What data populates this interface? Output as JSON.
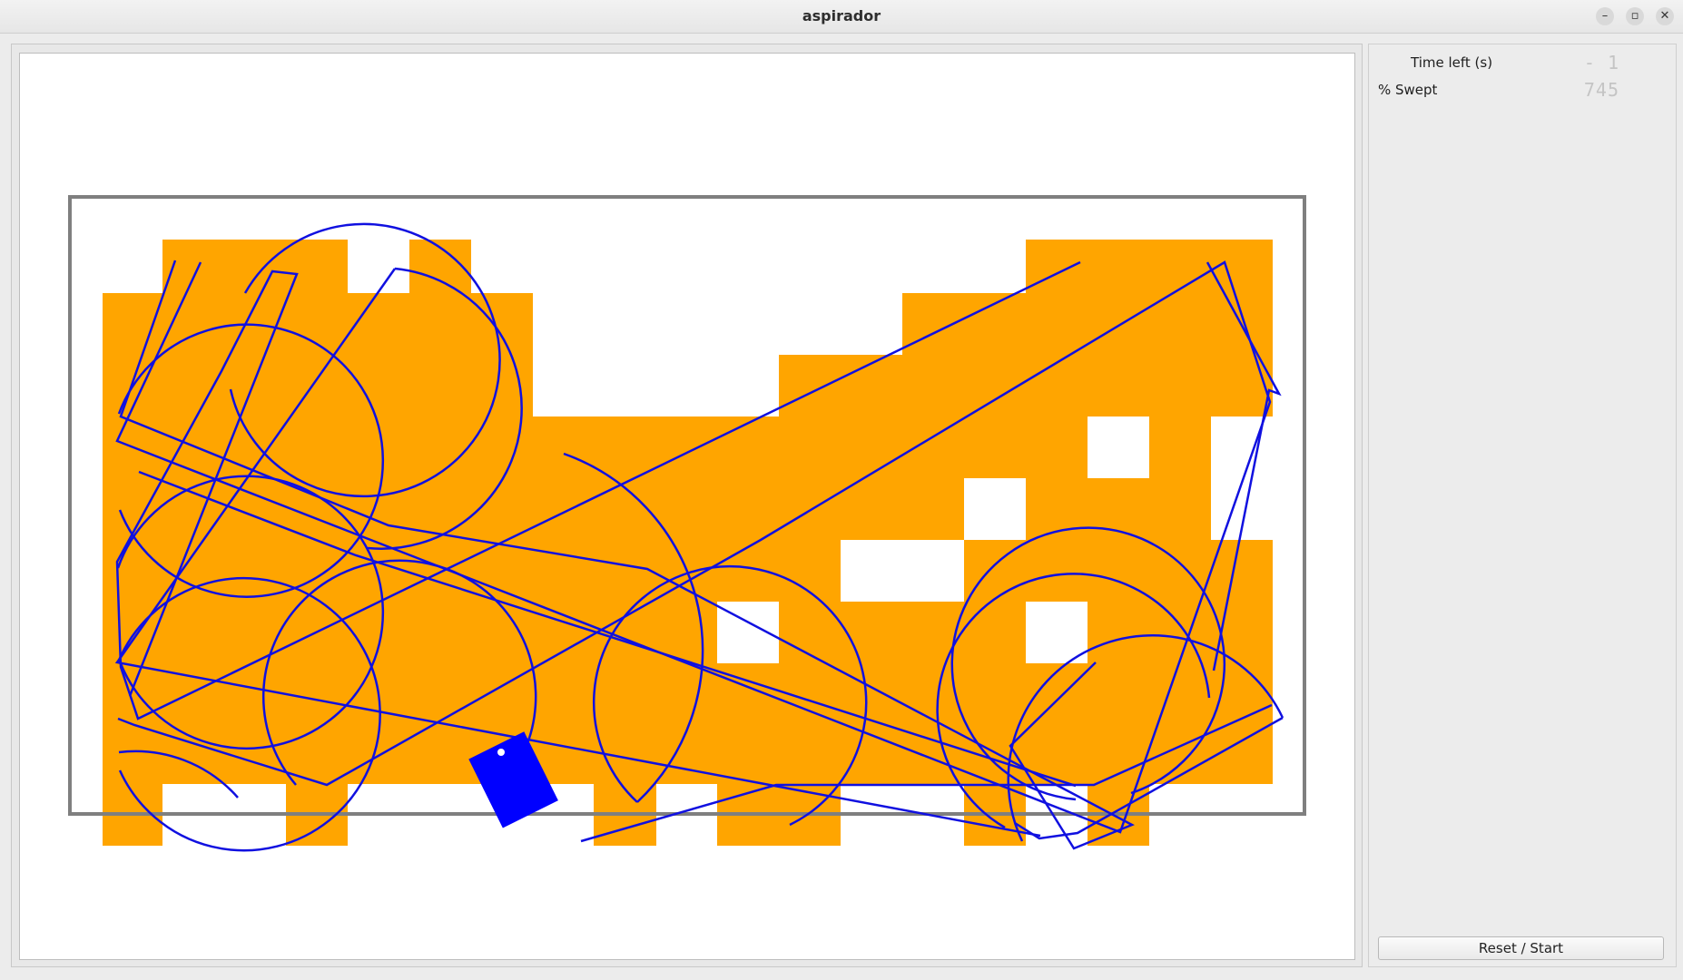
{
  "window": {
    "title": "aspirador",
    "minimize_glyph": "–",
    "restore_glyph": "▫",
    "close_glyph": "✕"
  },
  "stats": {
    "time_left_label": "Time left (s)",
    "time_left_value": "- 1",
    "swept_label": "% Swept",
    "swept_value": "745"
  },
  "controls": {
    "reset_label": "Reset / Start"
  },
  "colors": {
    "swept": "#FFA500",
    "path": "#1010E0",
    "robot": "#0000FF",
    "wall": "#7F7F7F",
    "floor": "#FFFFFF"
  }
}
